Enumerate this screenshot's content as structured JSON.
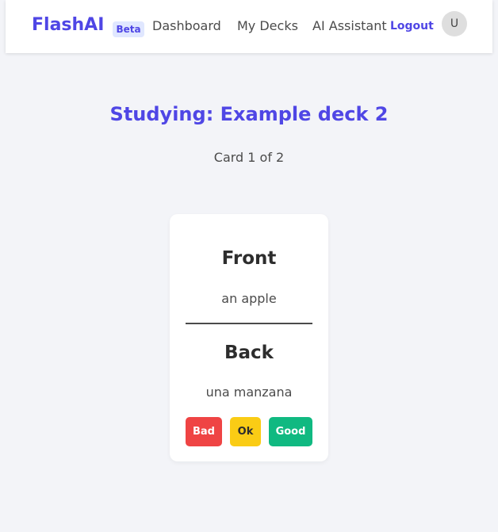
{
  "navbar": {
    "brand": "FlashAI",
    "badge": "Beta",
    "links": [
      "Dashboard",
      "My Decks",
      "AI Assistant"
    ],
    "logout": "Logout",
    "avatar_initial": "U"
  },
  "study": {
    "title": "Studying: Example deck 2",
    "progress": "Card 1 of 2"
  },
  "card": {
    "front_heading": "Front",
    "front_text": "an apple",
    "back_heading": "Back",
    "back_text": "una manzana"
  },
  "ratings": {
    "bad": "Bad",
    "ok": "Ok",
    "good": "Good"
  },
  "colors": {
    "accent": "#4f46e5",
    "bad": "#ef4444",
    "ok": "#facc15",
    "good": "#10b981"
  }
}
